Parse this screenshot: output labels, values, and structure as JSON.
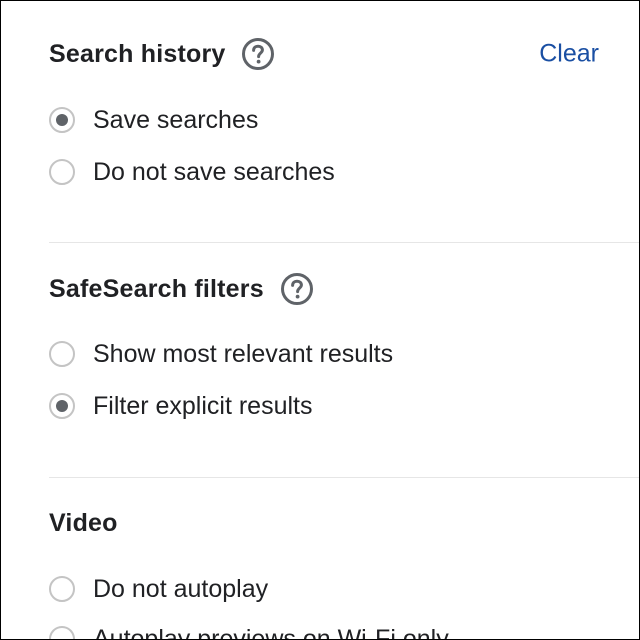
{
  "search_history": {
    "title": "Search history",
    "help_icon": "question-circle-icon",
    "clear_label": "Clear",
    "options": [
      {
        "label": "Save searches",
        "checked": true
      },
      {
        "label": "Do not save searches",
        "checked": false
      }
    ]
  },
  "safesearch": {
    "title": "SafeSearch filters",
    "help_icon": "question-circle-icon",
    "options": [
      {
        "label": "Show most relevant results",
        "checked": false
      },
      {
        "label": "Filter explicit results",
        "checked": true
      }
    ]
  },
  "video": {
    "title": "Video",
    "options": [
      {
        "label": "Do not autoplay",
        "checked": false
      },
      {
        "label": "Autoplay previews on Wi-Fi only",
        "checked": false
      }
    ]
  },
  "colors": {
    "link": "#1a4fa3",
    "radio_checked_dot": "#5f6368",
    "radio_border": "#c4c4c4",
    "divider": "#e6e6e6"
  }
}
